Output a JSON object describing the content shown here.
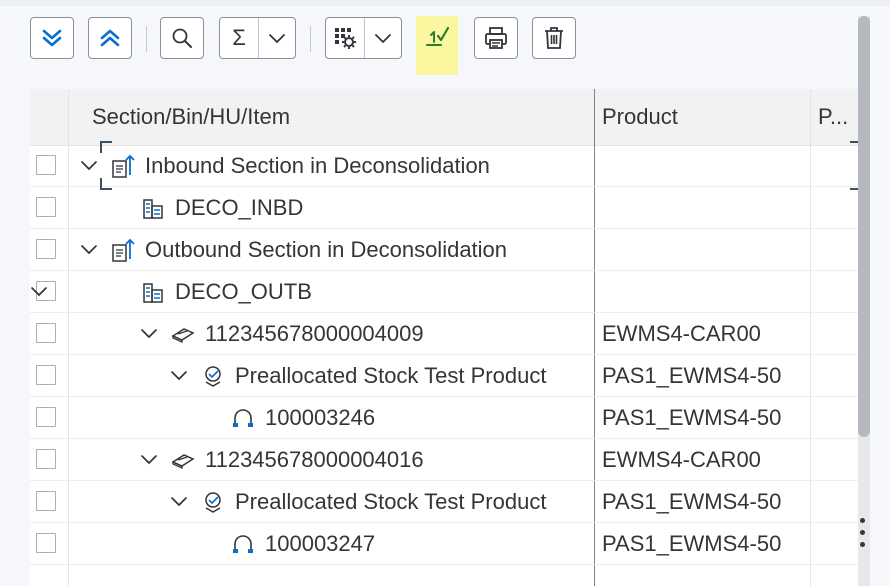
{
  "toolbar": {
    "buttons": [
      {
        "name": "expand-all",
        "icon": "double-chevron-down-icon"
      },
      {
        "name": "collapse-all",
        "icon": "double-chevron-up-icon"
      },
      {
        "name": "search",
        "icon": "search-icon"
      },
      {
        "name": "sum",
        "icon": "sum-icon",
        "glyph": "Σ"
      },
      {
        "name": "settings",
        "icon": "table-settings-icon"
      },
      {
        "name": "confirm",
        "icon": "confirm-check-icon"
      },
      {
        "name": "print",
        "icon": "print-icon"
      },
      {
        "name": "delete",
        "icon": "trash-icon"
      }
    ],
    "accent": "#0a6ed1",
    "highlight": "#fbf7a0"
  },
  "table": {
    "columns": [
      "Section/Bin/HU/Item",
      "Product",
      "P..."
    ],
    "rows": [
      {
        "level": 0,
        "expanded": true,
        "icon": "section-icon",
        "label": "Inbound Section in Deconsolidation",
        "product": ""
      },
      {
        "level": 1,
        "expanded": false,
        "icon": "storage-bin-icon",
        "label": "DECO_INBD",
        "product": ""
      },
      {
        "level": 0,
        "expanded": true,
        "icon": "section-icon",
        "label": "Outbound Section in Deconsolidation",
        "product": ""
      },
      {
        "level": 1,
        "expanded": true,
        "icon": "storage-bin-icon",
        "label": "DECO_OUTB",
        "product": ""
      },
      {
        "level": 2,
        "expanded": true,
        "icon": "handling-unit-icon",
        "label": "112345678000004009",
        "product": "EWMS4-CAR00"
      },
      {
        "level": 3,
        "expanded": true,
        "icon": "product-icon",
        "label": "Preallocated Stock Test Product",
        "product": "PAS1_EWMS4-50"
      },
      {
        "level": 4,
        "expanded": false,
        "icon": "stock-item-icon",
        "label": "100003246",
        "product": "PAS1_EWMS4-50"
      },
      {
        "level": 2,
        "expanded": true,
        "icon": "handling-unit-icon",
        "label": "112345678000004016",
        "product": "EWMS4-CAR00"
      },
      {
        "level": 3,
        "expanded": true,
        "icon": "product-icon",
        "label": "Preallocated Stock Test Product",
        "product": "PAS1_EWMS4-50"
      },
      {
        "level": 4,
        "expanded": false,
        "icon": "stock-item-icon",
        "label": "100003247",
        "product": "PAS1_EWMS4-50"
      }
    ]
  }
}
